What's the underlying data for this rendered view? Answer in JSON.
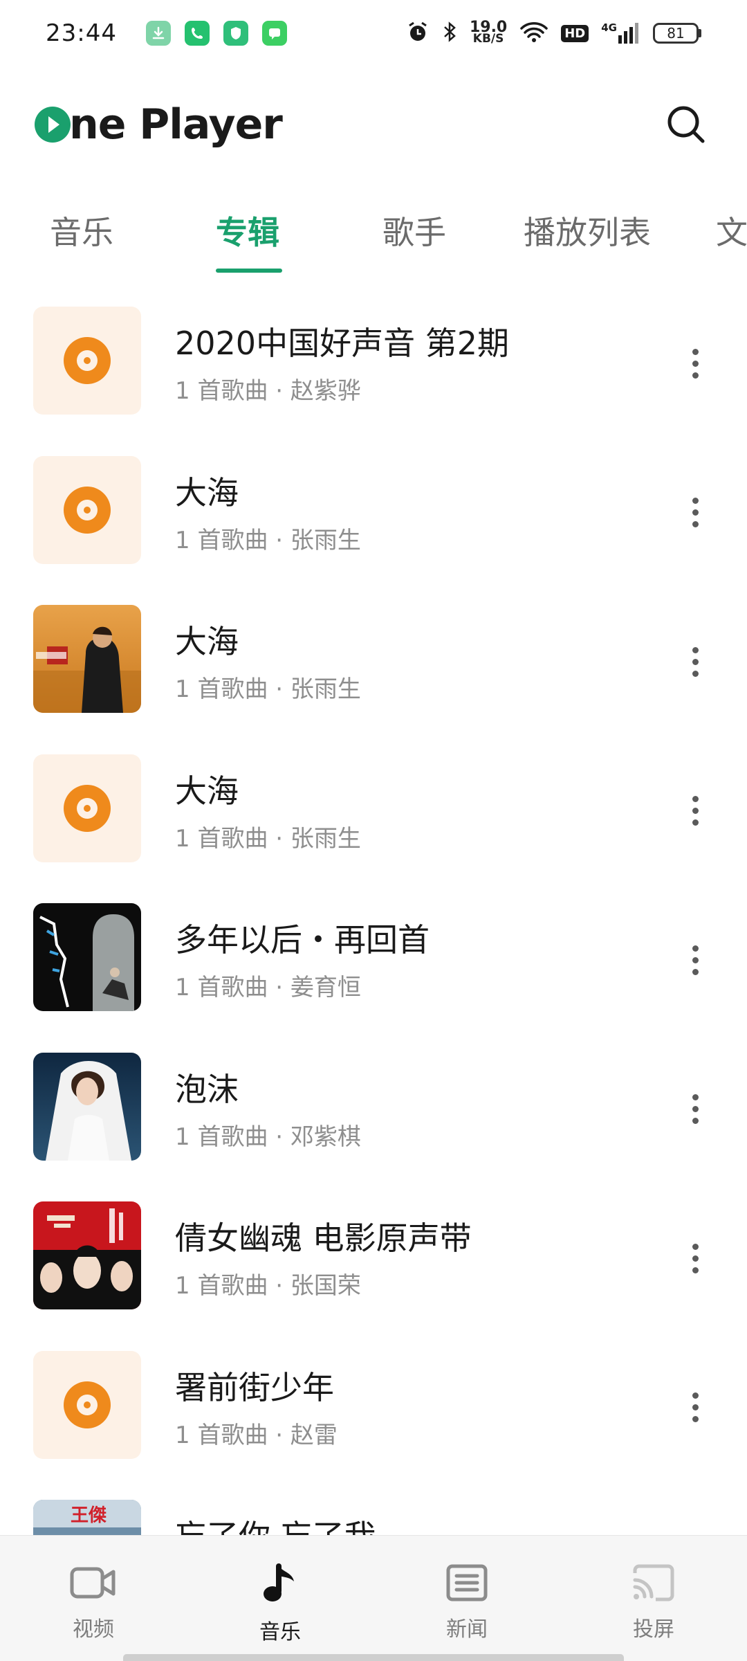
{
  "status_bar": {
    "time": "23:44",
    "net_speed_value": "19.0",
    "net_speed_unit": "KB/S",
    "hd_label": "HD",
    "network_label": "4G",
    "battery": "81",
    "app_icons": [
      {
        "name": "download-notification-icon",
        "color": "#7fd4a8"
      },
      {
        "name": "phone-notification-icon",
        "color": "#25c16f"
      },
      {
        "name": "shield-notification-icon",
        "color": "#2fbf7a"
      },
      {
        "name": "message-notification-icon",
        "color": "#3ccf63"
      }
    ]
  },
  "header": {
    "app_name": "ne Player",
    "brand_color": "#1aa06d"
  },
  "tabs": [
    {
      "label": "音乐",
      "active": false
    },
    {
      "label": "专辑",
      "active": true
    },
    {
      "label": "歌手",
      "active": false
    },
    {
      "label": "播放列表",
      "active": false
    },
    {
      "label": "文",
      "active": false
    }
  ],
  "albums": [
    {
      "title": "2020中国好声音 第2期",
      "subtitle": "1 首歌曲 · 赵紫骅",
      "cover": "placeholder"
    },
    {
      "title": "大海",
      "subtitle": "1 首歌曲 · 张雨生",
      "cover": "placeholder"
    },
    {
      "title": "大海",
      "subtitle": "1 首歌曲 · 张雨生",
      "cover": "photo-field"
    },
    {
      "title": "大海",
      "subtitle": "1 首歌曲 · 张雨生",
      "cover": "placeholder"
    },
    {
      "title": "多年以后・再回首",
      "subtitle": "1 首歌曲 · 姜育恒",
      "cover": "photo-dark"
    },
    {
      "title": "泡沫",
      "subtitle": "1 首歌曲 · 邓紫棋",
      "cover": "photo-bride"
    },
    {
      "title": "倩女幽魂 电影原声带",
      "subtitle": "1 首歌曲 · 张国荣",
      "cover": "photo-red"
    },
    {
      "title": "署前街少年",
      "subtitle": "1 首歌曲 · 赵雷",
      "cover": "placeholder"
    },
    {
      "title": "忘了你 忘了我",
      "subtitle": "",
      "cover": "photo-partial"
    }
  ],
  "bottom_nav": [
    {
      "label": "视频",
      "icon": "video-icon",
      "active": false
    },
    {
      "label": "音乐",
      "icon": "music-note-icon",
      "active": true
    },
    {
      "label": "新闻",
      "icon": "news-icon",
      "active": false
    },
    {
      "label": "投屏",
      "icon": "cast-icon",
      "active": false
    }
  ],
  "partial_cover_text": "王傑"
}
